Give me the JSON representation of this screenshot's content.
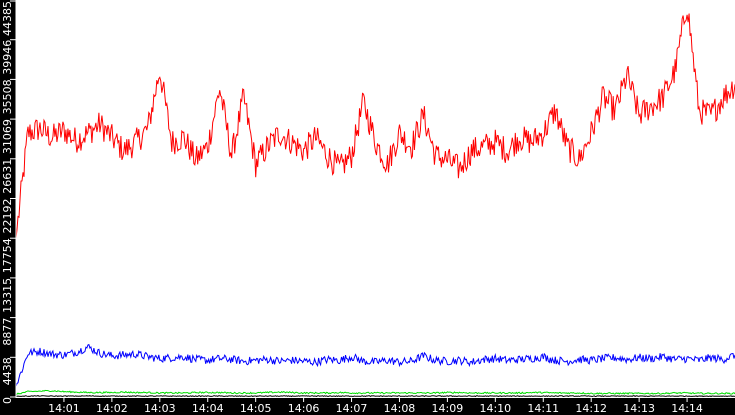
{
  "chart_data": {
    "type": "line",
    "title": "",
    "xlabel": "",
    "ylabel": "",
    "ylim": [
      0,
      44385
    ],
    "xlim_minutes": [
      0,
      15
    ],
    "x_start": "14:00",
    "sample_interval_seconds": 15,
    "y_ticks": [
      0,
      4438,
      8877,
      13315,
      17754,
      22192,
      26631,
      31069,
      35508,
      39946,
      44385
    ],
    "y_tick_labels": [
      "0",
      "4438",
      "8877",
      "13315",
      "17754",
      "22192",
      "26631",
      "31069",
      "35508",
      "39946",
      "44385"
    ],
    "x_ticks_minutes": [
      1,
      2,
      3,
      4,
      5,
      6,
      7,
      8,
      9,
      10,
      11,
      12,
      13,
      14
    ],
    "x_tick_labels": [
      "14:01",
      "14:02",
      "14:03",
      "14:04",
      "14:05",
      "14:06",
      "14:07",
      "14:08",
      "14:09",
      "14:10",
      "14:11",
      "14:12",
      "14:13",
      "14:14"
    ],
    "grid": false,
    "legend": "none",
    "series": [
      {
        "name": "red",
        "color": "#ff0000",
        "noise": 1500,
        "values": [
          17754,
          29500,
          30000,
          29000,
          29800,
          28700,
          29500,
          30500,
          29000,
          27500,
          28500,
          30000,
          36500,
          28500,
          29000,
          26500,
          28000,
          34500,
          27000,
          33500,
          26000,
          28000,
          29500,
          28500,
          27500,
          29000,
          27000,
          25500,
          27000,
          33000,
          28500,
          26000,
          29500,
          28000,
          31500,
          27000,
          26500,
          25500,
          27500,
          28000,
          28500,
          27500,
          29000,
          28500,
          29500,
          32000,
          28000,
          26500,
          29500,
          33500,
          32000,
          36000,
          31500,
          32500,
          33500,
          36500,
          44000,
          32000,
          31500,
          33500,
          35000
        ]
      },
      {
        "name": "blue",
        "color": "#0000ff",
        "noise": 450,
        "values": [
          1200,
          4900,
          5100,
          4800,
          4700,
          5000,
          5600,
          4900,
          4600,
          4700,
          4800,
          4500,
          4300,
          4400,
          4500,
          4200,
          4100,
          4300,
          4200,
          4000,
          4100,
          4200,
          4000,
          4100,
          4000,
          3900,
          4200,
          4100,
          4500,
          4000,
          3900,
          4100,
          3900,
          4000,
          4600,
          4100,
          4000,
          4100,
          3900,
          4200,
          4300,
          4100,
          4200,
          4300,
          4500,
          4100,
          4000,
          4200,
          4100,
          4300,
          4400,
          4200,
          4400,
          4300,
          4500,
          4200,
          4300,
          4100,
          4400,
          4200,
          4700
        ]
      },
      {
        "name": "green",
        "color": "#00dd00",
        "noise": 80,
        "values": [
          300,
          600,
          650,
          700,
          600,
          550,
          500,
          500,
          500,
          550,
          500,
          500,
          450,
          450,
          450,
          500,
          500,
          500,
          450,
          450,
          450,
          500,
          550,
          500,
          450,
          450,
          450,
          500,
          450,
          450,
          450,
          450,
          450,
          450,
          450,
          450,
          500,
          500,
          450,
          450,
          450,
          450,
          450,
          500,
          500,
          450,
          450,
          450,
          400,
          400,
          400,
          400,
          400,
          400,
          400,
          450,
          450,
          400,
          400,
          400,
          400
        ]
      },
      {
        "name": "black",
        "color": "#000000",
        "noise": 40,
        "values": [
          80,
          100,
          120,
          100,
          100,
          100,
          120,
          100,
          100,
          100,
          100,
          100,
          100,
          100,
          100,
          100,
          100,
          100,
          100,
          100,
          100,
          100,
          100,
          100,
          100,
          100,
          100,
          100,
          100,
          100,
          100,
          100,
          100,
          100,
          100,
          100,
          100,
          100,
          100,
          100,
          100,
          100,
          100,
          100,
          100,
          100,
          100,
          100,
          100,
          100,
          100,
          100,
          100,
          100,
          100,
          100,
          100,
          100,
          100,
          100,
          100
        ]
      }
    ]
  }
}
